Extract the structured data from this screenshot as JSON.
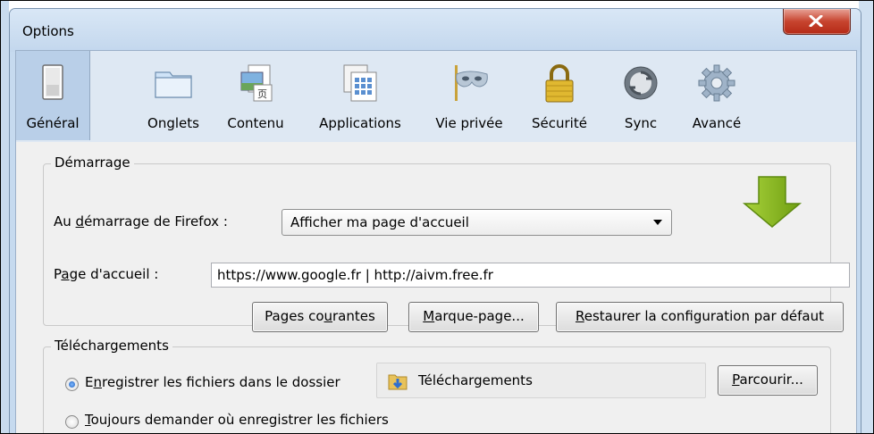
{
  "window": {
    "title": "Options"
  },
  "toolbar": {
    "panes": [
      {
        "label": "Général",
        "icon": "general-icon"
      },
      {
        "label": "Onglets",
        "icon": "tabs-icon"
      },
      {
        "label": "Contenu",
        "icon": "content-icon"
      },
      {
        "label": "Applications",
        "icon": "applications-icon"
      },
      {
        "label": "Vie privée",
        "icon": "privacy-mask-icon"
      },
      {
        "label": "Sécurité",
        "icon": "padlock-icon"
      },
      {
        "label": "Sync",
        "icon": "sync-icon"
      },
      {
        "label": "Avancé",
        "icon": "gear-icon"
      }
    ],
    "active": "Général"
  },
  "startup": {
    "legend": "Démarrage",
    "when_starts_label_pre": "Au ",
    "when_starts_label_key": "d",
    "when_starts_label_post": "émarrage de Firefox :",
    "when_starts_value": "Afficher ma page d'accueil",
    "homepage_label_pre": "P",
    "homepage_label_key": "a",
    "homepage_label_post": "ge d'accueil :",
    "homepage_value": "https://www.google.fr | http://aivm.free.fr",
    "btn_current_pre": "Pages co",
    "btn_current_key": "u",
    "btn_current_post": "rantes",
    "btn_bookmark_key": "M",
    "btn_bookmark_post": "arque-page...",
    "btn_restore_key": "R",
    "btn_restore_post": "estaurer la configuration par défaut"
  },
  "downloads": {
    "legend": "Téléchargements",
    "save_to_pre": "E",
    "save_to_key": "n",
    "save_to_post": "registrer les fichiers dans le dossier",
    "folder_name": "Téléchargements",
    "browse_key": "P",
    "browse_post": "arcourir...",
    "always_ask_key": "T",
    "always_ask_post": "oujours demander où enregistrer les fichiers",
    "selected_option": "save_to"
  },
  "colors": {
    "window_frame": "#c6daef",
    "active_pane": "#b9cfe8",
    "close_button": "#c7442f",
    "annotation_arrow": "#8fbf1a"
  }
}
